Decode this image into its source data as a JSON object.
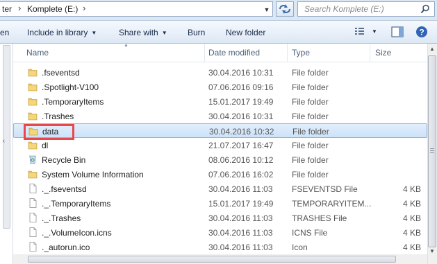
{
  "address": {
    "crumb_prev": "ter",
    "crumb_current": "Komplete (E:)",
    "search_placeholder": "Search Komplete (E:)"
  },
  "toolbar": {
    "open_label": "en",
    "include_label": "Include in library",
    "share_label": "Share with",
    "burn_label": "Burn",
    "newfolder_label": "New folder"
  },
  "columns": {
    "name": "Name",
    "date": "Date modified",
    "type": "Type",
    "size": "Size"
  },
  "files": [
    {
      "name": ".fseventsd",
      "date": "30.04.2016 10:31",
      "type": "File folder",
      "size": "",
      "icon": "folder-icon"
    },
    {
      "name": ".Spotlight-V100",
      "date": "07.06.2016 09:16",
      "type": "File folder",
      "size": "",
      "icon": "folder-icon"
    },
    {
      "name": ".TemporaryItems",
      "date": "15.01.2017 19:49",
      "type": "File folder",
      "size": "",
      "icon": "folder-icon"
    },
    {
      "name": ".Trashes",
      "date": "30.04.2016 10:31",
      "type": "File folder",
      "size": "",
      "icon": "folder-icon"
    },
    {
      "name": "data",
      "date": "30.04.2016 10:32",
      "type": "File folder",
      "size": "",
      "icon": "folder-icon"
    },
    {
      "name": "dl",
      "date": "21.07.2017 16:47",
      "type": "File folder",
      "size": "",
      "icon": "folder-icon"
    },
    {
      "name": "Recycle Bin",
      "date": "08.06.2016 10:12",
      "type": "File folder",
      "size": "",
      "icon": "recycle-bin-icon"
    },
    {
      "name": "System Volume Information",
      "date": "07.06.2016 16:02",
      "type": "File folder",
      "size": "",
      "icon": "folder-icon"
    },
    {
      "name": "._.fseventsd",
      "date": "30.04.2016 11:03",
      "type": "FSEVENTSD File",
      "size": "4 KB",
      "icon": "file-icon"
    },
    {
      "name": "._.TemporaryItems",
      "date": "15.01.2017 19:49",
      "type": "TEMPORARYITEM...",
      "size": "4 KB",
      "icon": "file-icon"
    },
    {
      "name": "._.Trashes",
      "date": "30.04.2016 11:03",
      "type": "TRASHES File",
      "size": "4 KB",
      "icon": "file-icon"
    },
    {
      "name": "._.VolumeIcon.icns",
      "date": "30.04.2016 11:03",
      "type": "ICNS File",
      "size": "4 KB",
      "icon": "file-icon"
    },
    {
      "name": "._autorun.ico",
      "date": "30.04.2016 11:03",
      "type": "Icon",
      "size": "4 KB",
      "icon": "file-icon"
    }
  ],
  "selected_index": 4,
  "colors": {
    "highlight_border": "#e8474b",
    "selection_fill": "#cde2f8",
    "folder": "#e8c25b"
  }
}
